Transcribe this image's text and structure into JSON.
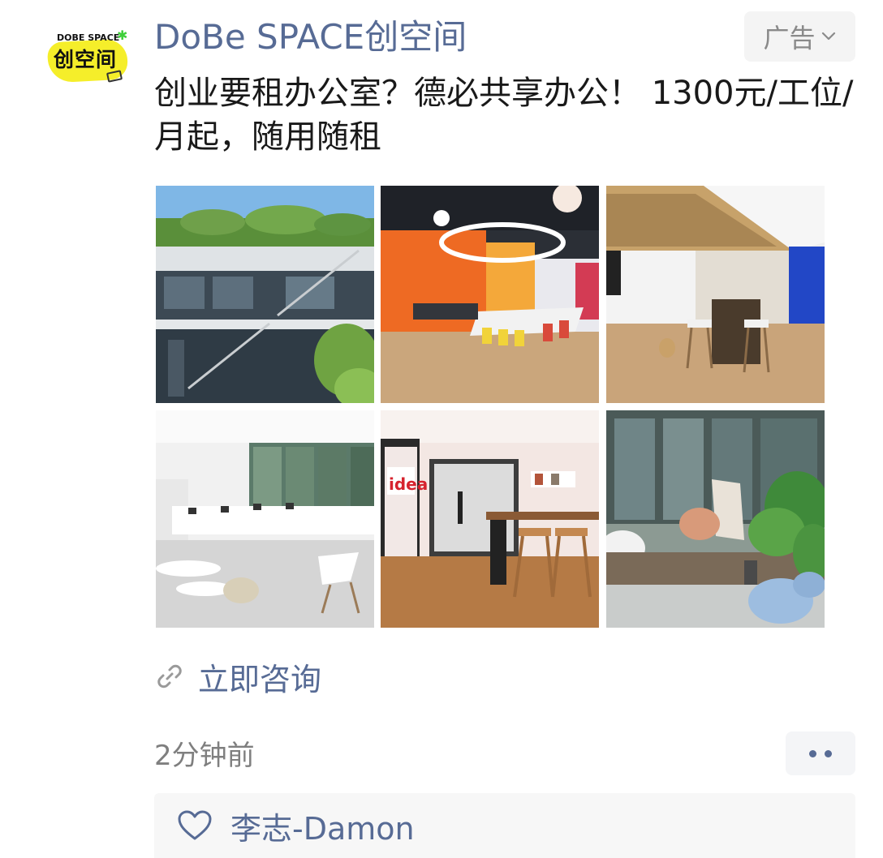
{
  "post": {
    "avatar": {
      "logo_top_text": "DOBE SPACE",
      "logo_main_text": "创空间",
      "logo_color": "#f5ee2a"
    },
    "account_name": "DoBe SPACE创空间",
    "ad_tag": {
      "label": "广告",
      "icon": "chevron-down-icon"
    },
    "ad_text": "创业要租办公室？德必共享办公！ 1300元/工位/月起，随用随租",
    "photos": [
      {
        "name": "photo-building-exterior"
      },
      {
        "name": "photo-meeting-room-orange"
      },
      {
        "name": "photo-lounge-bar-tables"
      },
      {
        "name": "photo-open-office-desks"
      },
      {
        "name": "photo-idea-glass-room"
      },
      {
        "name": "photo-garden-patio"
      }
    ],
    "cta": {
      "icon": "link-icon",
      "label": "立即咨询"
    },
    "timestamp": "2分钟前",
    "more_icon": "more-dots-icon",
    "likes": {
      "icon": "heart-icon",
      "names": "李志-Damon"
    }
  },
  "colors": {
    "link_blue": "#576b95",
    "muted_gray": "#8a8a8a",
    "panel_gray": "#f7f7f7"
  }
}
